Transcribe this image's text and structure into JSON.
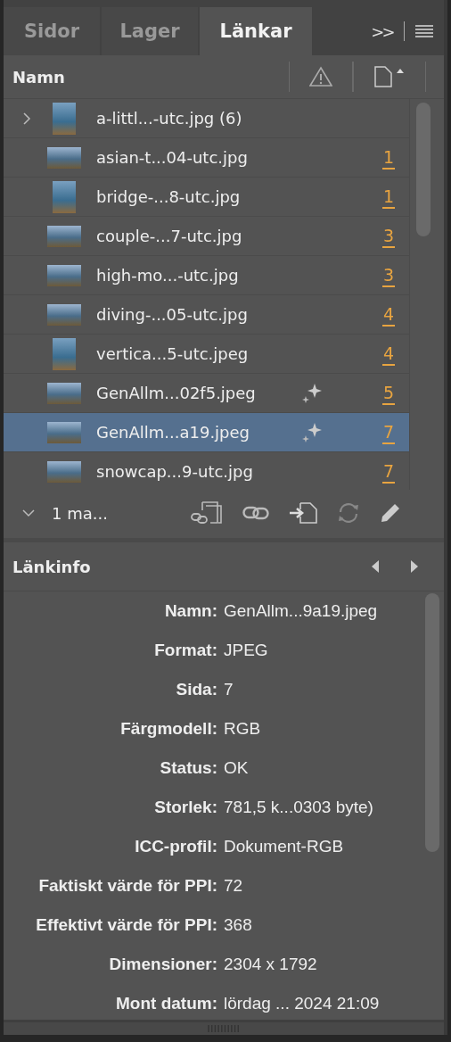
{
  "tabs": [
    {
      "label": "Sidor",
      "selected": false
    },
    {
      "label": "Lager",
      "selected": false
    },
    {
      "label": "Länkar",
      "selected": true
    }
  ],
  "overflow": ">>",
  "list_header": {
    "name": "Namn"
  },
  "links": [
    {
      "name": "a-littl...-utc.jpg (6)",
      "kind": "portrait",
      "expanded": false,
      "ai": false,
      "selected": false
    },
    {
      "name": "asian-t...04-utc.jpg",
      "kind": "landscape",
      "ai": false,
      "page": "1",
      "selected": false
    },
    {
      "name": "bridge-...8-utc.jpg",
      "kind": "portrait",
      "ai": false,
      "page": "1",
      "selected": false
    },
    {
      "name": "couple-...7-utc.jpg",
      "kind": "landscape",
      "ai": false,
      "page": "3",
      "selected": false
    },
    {
      "name": "high-mo...-utc.jpg",
      "kind": "landscape",
      "ai": false,
      "page": "3",
      "selected": false
    },
    {
      "name": "diving-...05-utc.jpg",
      "kind": "landscape",
      "ai": false,
      "page": "4",
      "selected": false
    },
    {
      "name": "vertica...5-utc.jpeg",
      "kind": "portrait",
      "ai": false,
      "page": "4",
      "selected": false
    },
    {
      "name": "GenAllm...02f5.jpeg",
      "kind": "landscape",
      "ai": true,
      "page": "5",
      "selected": false
    },
    {
      "name": "GenAllm...a19.jpeg",
      "kind": "landscape",
      "ai": true,
      "page": "7",
      "selected": true
    },
    {
      "name": "snowcap...9-utc.jpg",
      "kind": "landscape",
      "ai": false,
      "page": "7",
      "selected": false
    }
  ],
  "selection": {
    "label": "1 ma...",
    "expanded": true
  },
  "link_info": {
    "title": "Länkinfo",
    "fields": [
      {
        "label": "Namn:",
        "value": "GenAllm...9a19.jpeg"
      },
      {
        "label": "Format:",
        "value": "JPEG"
      },
      {
        "label": "Sida:",
        "value": "7"
      },
      {
        "label": "Färgmodell:",
        "value": "RGB"
      },
      {
        "label": "Status:",
        "value": "OK"
      },
      {
        "label": "Storlek:",
        "value": "781,5 k...0303 byte)"
      },
      {
        "label": "ICC-profil:",
        "value": "Dokument-RGB"
      },
      {
        "label": "Faktiskt värde för PPI:",
        "value": "72"
      },
      {
        "label": "Effektivt värde för PPI:",
        "value": "368"
      },
      {
        "label": "Dimensioner:",
        "value": "2304 x 1792"
      },
      {
        "label": "Mont datum:",
        "value": "lördag ... 2024 21:09"
      }
    ]
  }
}
